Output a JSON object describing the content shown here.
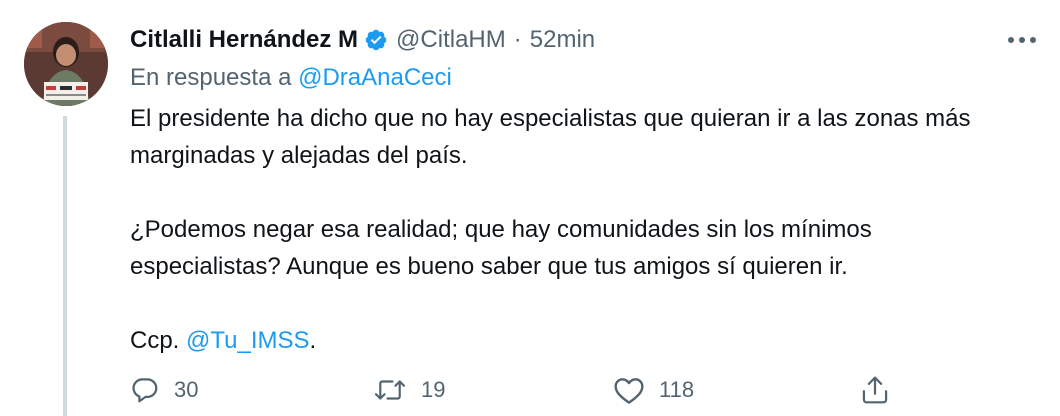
{
  "tweet": {
    "author_name": "Citlalli Hernández M",
    "handle": "@CitlaHM",
    "separator": "·",
    "time": "52min",
    "reply_prefix": "En respuesta a",
    "reply_to": "@DraAnaCeci",
    "paragraph1": "El presidente ha dicho que no hay especialistas que quieran ir a las zonas más marginadas y alejadas del país.",
    "paragraph2": "¿Podemos negar esa realidad; que hay comunidades sin los mínimos especialistas? Aunque es bueno saber que tus amigos sí quieren ir.",
    "cc_prefix": "Ccp.",
    "cc_mention": "@Tu_IMSS",
    "cc_suffix": "."
  },
  "actions": {
    "replies": "30",
    "retweets": "19",
    "likes": "118"
  },
  "icons": {
    "verified": "verified-badge-icon",
    "more": "more-icon",
    "reply": "reply-icon",
    "retweet": "retweet-icon",
    "like": "heart-icon",
    "share": "share-icon"
  },
  "colors": {
    "accent": "#1d9bf0",
    "text": "#0f1419",
    "muted": "#536471",
    "thread_line": "#cfd9de"
  }
}
